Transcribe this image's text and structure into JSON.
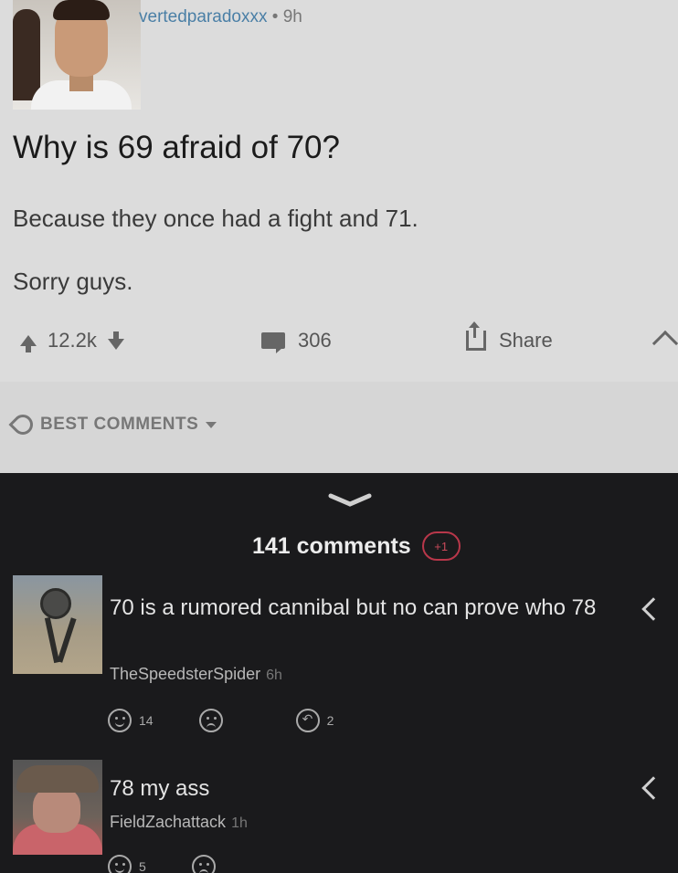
{
  "post": {
    "username": "vertedparadoxxx",
    "separator": "•",
    "time": "9h",
    "title": "Why is 69 afraid of 70?",
    "body_line1": "Because they once had a fight and 71.",
    "body_line2": "Sorry guys.",
    "votes": "12.2k",
    "comments": "306",
    "share_label": "Share"
  },
  "sort": {
    "label": "BEST COMMENTS"
  },
  "comments_header": {
    "count_label": "141 comments",
    "new_badge": "+1"
  },
  "comments": [
    {
      "text": "70 is a rumored cannibal but no can prove who 78",
      "author": "TheSpeedsterSpider",
      "age": "6h",
      "likes": "14",
      "replies": "2"
    },
    {
      "text": "78 my ass",
      "author": "FieldZachattack",
      "age": "1h",
      "likes": "5"
    }
  ],
  "colors": {
    "post_bg": "#dcdcdc",
    "dark_bg": "#1a1a1c",
    "username": "#4a7fa6",
    "badge": "#b8374a"
  }
}
